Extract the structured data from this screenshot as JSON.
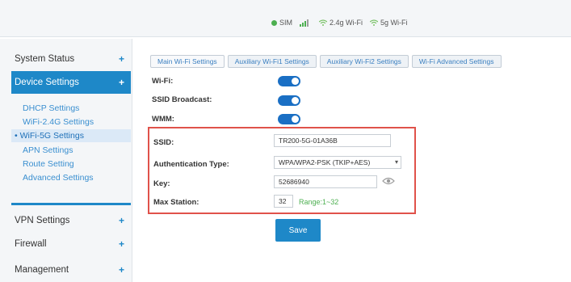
{
  "status_bar": {
    "sim_label": "SIM",
    "wifi24_label": "2.4g Wi-Fi",
    "wifi5_label": "5g Wi-Fi",
    "colors": {
      "sim_dot": "#4caf50",
      "wifi": "#7cc36a"
    }
  },
  "sidebar": {
    "system_status": "System Status",
    "device_settings": "Device Settings",
    "sub_items": [
      "DHCP Settings",
      "WiFi-2.4G Settings",
      "WiFi-5G Settings",
      "APN Settings",
      "Route Setting",
      "Advanced Settings"
    ],
    "vpn_settings": "VPN Settings",
    "firewall": "Firewall",
    "management": "Management",
    "expand_symbol": "+"
  },
  "tabs": [
    "Main Wi-Fi Settings",
    "Auxiliary Wi-Fi1 Settings",
    "Auxiliary Wi-Fi2 Settings",
    "Wi-Fi Advanced Settings"
  ],
  "form": {
    "wifi_label": "Wi-Fi:",
    "wifi_on": true,
    "ssid_broadcast_label": "SSID Broadcast:",
    "ssid_broadcast_on": true,
    "wmm_label": "WMM:",
    "wmm_on": true,
    "ssid_label": "SSID:",
    "ssid_value": "TR200-5G-01A36B",
    "auth_label": "Authentication Type:",
    "auth_value": "WPA/WPA2-PSK (TKIP+AES)",
    "key_label": "Key:",
    "key_value": "52686940",
    "max_station_label": "Max Station:",
    "max_station_value": "32",
    "range_text": "Range:1~32",
    "save_label": "Save"
  },
  "colors": {
    "accent": "#1e88c8",
    "highlight_box": "#e0524a"
  }
}
